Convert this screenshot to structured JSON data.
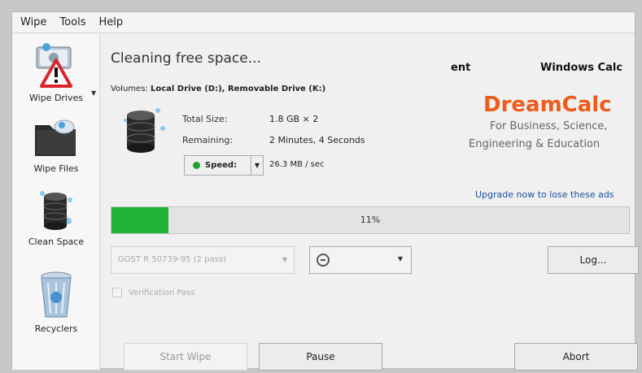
{
  "menu": [
    "Wipe",
    "Tools",
    "Help"
  ],
  "sidebar": {
    "items": [
      {
        "label": "Wipe Drives"
      },
      {
        "label": "Wipe Files"
      },
      {
        "label": "Clean Space"
      },
      {
        "label": "Recyclers"
      }
    ]
  },
  "status": {
    "title": "Cleaning free space...",
    "volumes_label": "Volumes: ",
    "volumes_value": "Local Drive (D:), Removable Drive (K:)",
    "total_size_label": "Total Size:",
    "total_size_value": "1.8 GB × 2",
    "remaining_label": "Remaining:",
    "remaining_value": "2 Minutes, 4 Seconds",
    "speed_label": "Speed:",
    "speed_value": "26.3 MB / sec"
  },
  "ad": {
    "fragment1": "ent",
    "fragment2": "Windows Calc",
    "brand": "DreamCalc",
    "tagline1": "For Business, Science,",
    "tagline2": "Engineering & Education",
    "upgrade_link": "Upgrade now to lose these ads"
  },
  "progress": {
    "percent_text": "11%",
    "fraction": 0.11
  },
  "options": {
    "method": "GOST R 50739-95 (2 pass)",
    "verification_label": "Verification Pass",
    "verification_checked": false
  },
  "buttons": {
    "log": "Log...",
    "start": "Start Wipe",
    "pause": "Pause",
    "abort": "Abort"
  },
  "colors": {
    "accent": "#f05a1a",
    "progress": "#22b23a",
    "link": "#1a4fa0"
  }
}
